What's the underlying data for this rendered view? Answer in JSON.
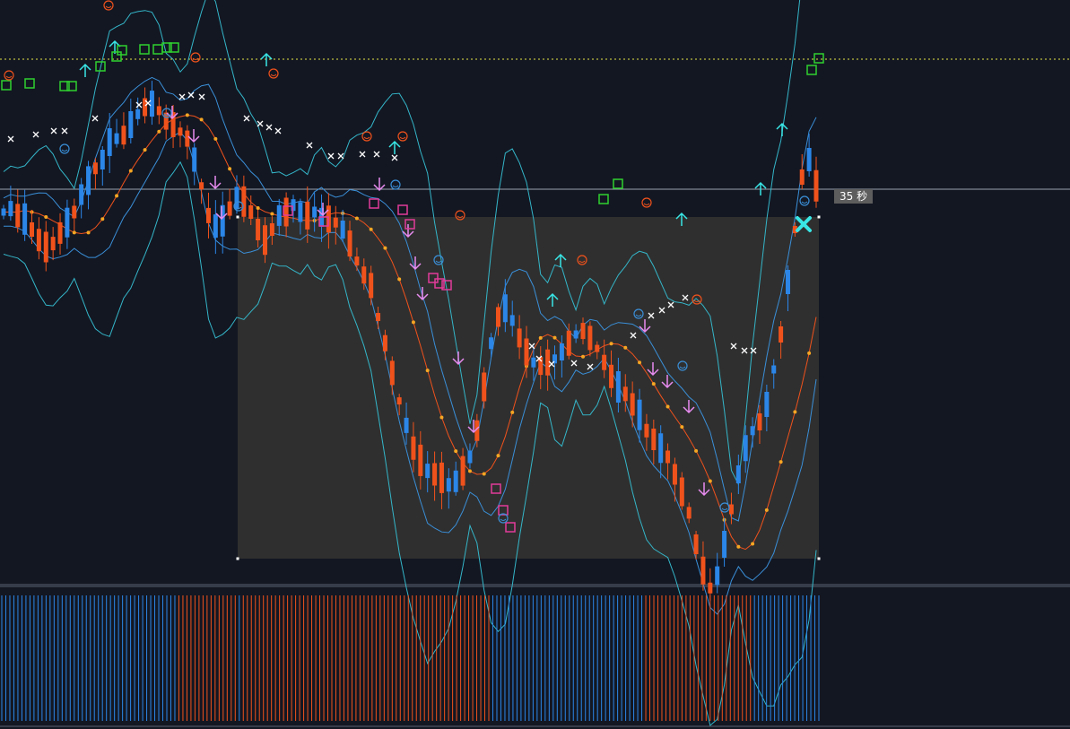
{
  "timer": {
    "value": "35",
    "unit": "秒"
  },
  "colors": {
    "background": "#131722",
    "selection_box": "#2f2f2f",
    "bull": "#2b86e8",
    "bear": "#f0521c",
    "band": "#34b6c9",
    "inner_band": "#3a8fd8",
    "ma_dots": "#f5a623",
    "resistance_dotted": "#e6e645",
    "support_line": "#9aa3b0",
    "buy_arrow": "#39e6e6",
    "sell_arrow": "#e88cf0",
    "green_box": "#2fd12f",
    "pink_box": "#e23c9a",
    "smile_red": "#f0521c",
    "smile_blue": "#3a8fd8"
  },
  "chart_data": [
    {
      "type": "candlestick",
      "candle_count": 116,
      "trend_path": [
        0.7,
        0.68,
        0.72,
        0.74,
        0.8,
        0.86,
        0.9,
        0.88,
        0.82,
        0.76,
        0.7,
        0.6,
        0.52,
        0.45,
        0.4,
        0.3,
        0.28,
        0.26,
        0.2,
        0.14,
        0.1,
        0.08,
        0.12,
        0.18,
        0.2,
        0.24,
        0.28,
        0.4,
        0.55,
        0.72,
        0.78,
        0.75,
        0.68,
        0.62,
        0.64,
        0.7,
        0.8,
        0.86,
        0.8,
        0.72,
        0.7,
        0.66,
        0.7,
        0.72,
        0.7,
        0.73,
        0.74,
        0.76,
        0.8,
        0.88,
        0.98,
        1.06,
        1.12,
        1.3,
        1.45,
        1.62,
        1.78,
        1.92,
        2.05,
        2.12,
        2.18,
        2.2,
        2.22,
        2.26,
        2.24,
        2.18,
        2.1,
        1.95,
        1.7,
        1.45,
        1.3,
        1.25,
        1.32,
        1.42,
        1.5,
        1.56,
        1.58,
        1.56,
        1.54,
        1.5,
        1.45,
        1.4,
        1.38,
        1.42,
        1.48,
        1.56,
        1.64,
        1.7,
        1.74,
        1.8,
        1.86,
        1.95,
        2.0,
        2.05,
        2.1,
        2.2,
        2.3,
        2.42,
        2.6,
        2.75,
        2.85,
        2.78,
        2.6,
        2.4,
        2.2,
        2.05,
        1.95,
        1.9,
        1.8,
        1.6,
        1.4,
        1.1,
        0.8,
        0.5,
        0.4,
        0.55
      ],
      "resistance_line": "dotted",
      "support_line": "solid"
    },
    {
      "type": "histogram",
      "bar_colors_sequence": [
        "blue",
        "blue",
        "blue",
        "blue",
        "blue",
        "blue",
        "blue",
        "blue",
        "blue",
        "blue",
        "blue",
        "blue",
        "blue",
        "blue",
        "blue",
        "blue",
        "blue",
        "blue",
        "blue",
        "blue",
        "blue",
        "blue",
        "blue",
        "blue",
        "blue",
        "blue",
        "blue",
        "blue",
        "blue",
        "blue",
        "blue",
        "blue",
        "blue",
        "blue",
        "blue",
        "blue",
        "blue",
        "blue",
        "blue",
        "blue",
        "blue",
        "blue",
        "blue",
        "blue",
        "orange",
        "orange",
        "orange",
        "orange",
        "orange",
        "orange",
        "orange",
        "orange",
        "orange",
        "orange",
        "orange",
        "orange",
        "orange",
        "orange",
        "orange",
        "blue",
        "orange",
        "orange",
        "orange",
        "orange",
        "orange",
        "orange",
        "orange",
        "orange",
        "orange",
        "orange",
        "orange",
        "orange",
        "orange",
        "orange",
        "orange",
        "orange",
        "orange",
        "orange",
        "orange",
        "orange",
        "orange",
        "orange",
        "orange",
        "orange",
        "orange",
        "orange",
        "orange",
        "orange",
        "orange",
        "orange",
        "orange",
        "orange",
        "orange",
        "orange",
        "orange",
        "orange",
        "orange",
        "orange",
        "orange",
        "orange",
        "orange",
        "orange",
        "orange",
        "orange",
        "orange",
        "orange",
        "orange",
        "orange",
        "orange",
        "orange",
        "orange",
        "orange",
        "orange",
        "orange",
        "orange",
        "orange",
        "orange",
        "orange",
        "orange",
        "orange",
        "orange",
        "orange",
        "blue",
        "blue",
        "blue",
        "blue",
        "blue",
        "blue",
        "blue",
        "blue",
        "blue",
        "blue",
        "blue",
        "blue",
        "blue",
        "blue",
        "blue",
        "blue",
        "blue",
        "blue",
        "blue",
        "blue",
        "blue",
        "blue",
        "blue",
        "blue",
        "blue",
        "blue",
        "blue",
        "blue",
        "blue",
        "blue",
        "blue",
        "blue",
        "blue",
        "blue",
        "blue",
        "blue",
        "blue",
        "blue",
        "orange",
        "orange",
        "orange",
        "orange",
        "orange",
        "orange",
        "orange",
        "orange",
        "orange",
        "orange",
        "orange",
        "orange",
        "orange",
        "orange",
        "orange",
        "orange",
        "orange",
        "orange",
        "orange",
        "orange",
        "orange",
        "orange",
        "orange",
        "orange",
        "orange",
        "orange",
        "orange",
        "blue",
        "blue",
        "blue",
        "blue",
        "blue",
        "blue",
        "blue",
        "blue",
        "blue",
        "blue",
        "blue",
        "blue",
        "blue",
        "blue",
        "blue",
        "blue",
        "blue"
      ]
    }
  ]
}
